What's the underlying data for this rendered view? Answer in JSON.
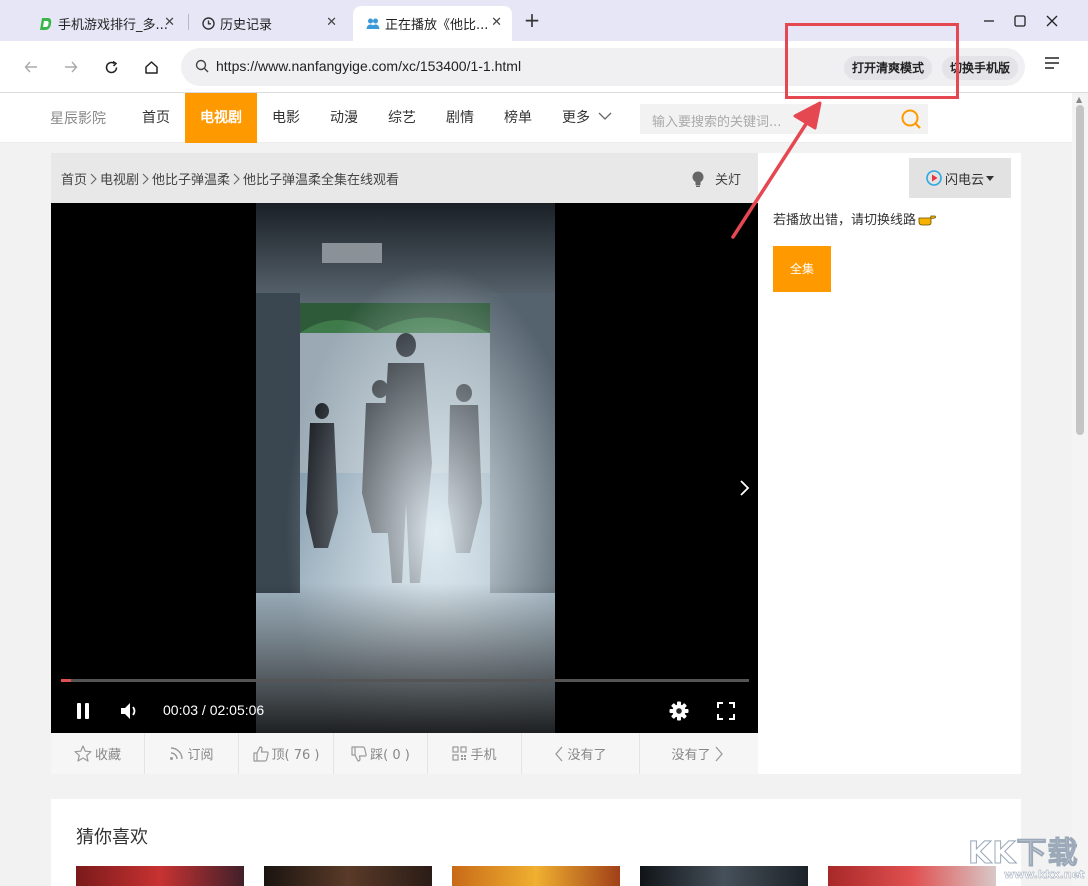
{
  "browser": {
    "tabs": [
      {
        "label": "手机游戏排行_多...",
        "icon": "site-d-icon",
        "active": false
      },
      {
        "label": "历史记录",
        "icon": "clock-icon",
        "active": false
      },
      {
        "label": "正在播放《他比...",
        "icon": "users-icon",
        "active": true
      }
    ],
    "new_tab": "+",
    "url": "https://www.nanfangyige.com/xc/153400/1-1.html",
    "clear_mode_label": "打开清爽模式",
    "mobile_label": "切换手机版"
  },
  "site": {
    "name": "星辰影院",
    "nav": [
      "首页",
      "电视剧",
      "电影",
      "动漫",
      "综艺",
      "剧情",
      "榜单",
      "更多"
    ],
    "active_nav": "电视剧",
    "search_placeholder": "输入要搜索的关键词..."
  },
  "breadcrumb": [
    "首页",
    "电视剧",
    "他比子弹温柔",
    "他比子弹温柔全集在线观看"
  ],
  "lights_off_label": "关灯",
  "player": {
    "current_time": "00:03",
    "duration": "02:05:06",
    "time_display": "00:03 / 02:05:06",
    "progress": 0.0004,
    "state": "playing"
  },
  "actions": [
    {
      "label": "收藏",
      "icon": "star-icon"
    },
    {
      "label": "订阅",
      "icon": "rss-icon"
    },
    {
      "label": "顶( 76 )",
      "icon": "thumbs-up-icon"
    },
    {
      "label": "踩( 0 )",
      "icon": "thumbs-down-icon"
    },
    {
      "label": "手机",
      "icon": "qr-code-icon"
    },
    {
      "label": "没有了",
      "icon": "chevron-left-icon"
    },
    {
      "label": "没有了",
      "icon": "chevron-right-icon"
    }
  ],
  "side": {
    "line_label": "闪电云",
    "tip": "若播放出错，请切换线路",
    "all_episodes": "全集"
  },
  "guess_title": "猜你喜欢",
  "watermark": {
    "main": "KK下载",
    "sub": "www.kkx.net"
  },
  "colors": {
    "accent": "#ff9900",
    "annotation": "#e54850"
  }
}
